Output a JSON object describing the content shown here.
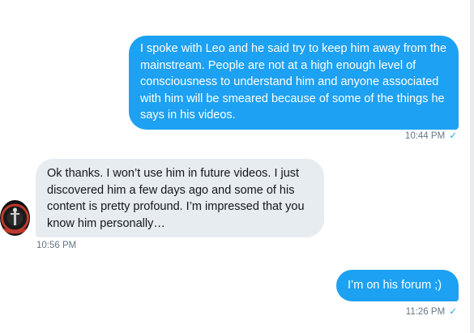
{
  "messages": [
    {
      "direction": "outgoing",
      "text": "I spoke with Leo and he said try to keep him away from the mainstream. People are not at a high enough level of consciousness to understand him and anyone associated with him will be smeared because of some of the things he says in his videos.",
      "time": "10:44 PM",
      "read": true
    },
    {
      "direction": "incoming",
      "text": "Ok thanks. I won’t use him in future videos. I just discovered him a few days ago and some of his content is pretty profound. I’m impressed that you know him personally…",
      "time": "10:56 PM",
      "avatar_icon": "user-avatar-icon"
    },
    {
      "direction": "outgoing",
      "text": "I’m on his forum ;)",
      "time": "11:26 PM",
      "read": true
    }
  ],
  "read_check": "✓",
  "colors": {
    "outgoing_bubble": "#1da1f2",
    "incoming_bubble": "#e6ecf0",
    "timestamp": "#657786",
    "check": "#1da1f2"
  }
}
